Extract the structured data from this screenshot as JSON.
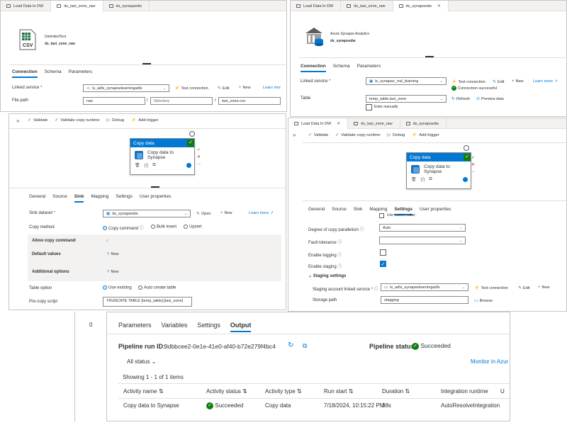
{
  "panel_tl": {
    "tabs": [
      "Load Data In DW",
      "ds_taxi_zone_raw",
      "ds_synaspedw"
    ],
    "dataset_type": "DelimitedText",
    "dataset_name": "ds_taxi_zone_raw",
    "icon_text": "CSV",
    "subtabs": [
      "Connection",
      "Schema",
      "Parameters"
    ],
    "linked_service_label": "Linked service",
    "linked_service_value": "ls_adls_synapselearningadls",
    "test_connection": "Test connection",
    "edit": "Edit",
    "new": "New",
    "learn_more": "Learn mor",
    "file_path_label": "File path",
    "file_path_container": "raw",
    "file_path_directory_placeholder": "Directory",
    "file_path_file": "taxi_zone.csv",
    "slash": "/"
  },
  "panel_tr": {
    "tabs": [
      "Load Data In DW",
      "ds_taxi_zone_raw",
      "ds_synapsedw"
    ],
    "dataset_type": "Azure Synapse Analytics",
    "dataset_name": "ds_synapsedw",
    "subtabs": [
      "Connection",
      "Schema",
      "Parameters"
    ],
    "linked_service_label": "Linked service",
    "linked_service_value": "ls_synapse_rnd_learning",
    "test_connection": "Test connection",
    "connection_status": "Connection successful",
    "edit": "Edit",
    "new": "New",
    "learn_more": "Learn more",
    "table_label": "Table",
    "table_value": "temp_table.taxi_zone",
    "refresh": "Refresh",
    "preview": "Preview data",
    "enter_manually": "Enter manually"
  },
  "panel_ml": {
    "toolbar": [
      "Validate",
      "Validate copy runtime",
      "Debug",
      "Add trigger"
    ],
    "activity_title": "Copy data",
    "activity_name": "Copy data to Synapse",
    "subtabs": [
      "General",
      "Source",
      "Sink",
      "Mapping",
      "Settings",
      "User properties"
    ],
    "sink_dataset_label": "Sink dataset",
    "sink_dataset_value": "ds_synapsedw",
    "open": "Open",
    "new": "New",
    "learn_more": "Learn more",
    "copy_method_label": "Copy method",
    "copy_methods": [
      "Copy command",
      "Bulk insert",
      "Upsert"
    ],
    "allow_copy_command": "Allow copy command",
    "default_values": "Default values",
    "additional_options": "Additional options",
    "table_option_label": "Table option",
    "table_options": [
      "Use existing",
      "Auto create table"
    ],
    "precopy_label": "Pre-copy script",
    "precopy_value": "TRUNCATE TABLE [temp_table].[taxi_zone]",
    "new_plus": "New",
    "expand": "»"
  },
  "panel_mr": {
    "tabs": [
      "Load Data In DW",
      "ds_taxi_zone_raw",
      "ds_synapsedw"
    ],
    "toolbar": [
      "Validate",
      "Validate copy runtime",
      "Debug",
      "Add trigger"
    ],
    "activity_title": "Copy data",
    "activity_name": "Copy data to Synapse",
    "subtabs": [
      "General",
      "Source",
      "Sink",
      "Mapping",
      "Settings",
      "User properties"
    ],
    "use_custom_value": "Use custom value",
    "parallelism_label": "Degree of copy parallelism",
    "parallelism_value": "Auto",
    "fault_label": "Fault tolerance",
    "logging_label": "Enable logging",
    "staging_label": "Enable staging",
    "staging_settings": "Staging settings",
    "staging_ls_label": "Staging account linked service",
    "staging_ls_value": "ls_adls_synapselearningadls",
    "test_connection": "Test connection",
    "edit": "Edit",
    "new": "New",
    "storage_path_label": "Storage path",
    "storage_path_value": "stagging",
    "browse": "Browse",
    "expand": "»"
  },
  "panel_bottom": {
    "side_value": "0",
    "tabs": [
      "Parameters",
      "Variables",
      "Settings",
      "Output"
    ],
    "run_id_label": "Pipeline run ID:",
    "run_id_value": "9dbbcee2-0e1e-41e0-af40-b72e279f4bc4",
    "status_label": "Pipeline status",
    "status_value": "Succeeded",
    "filter": "All status",
    "monitor": "Monitor in Azur",
    "showing": "Showing 1 - 1 of 1 items",
    "columns": [
      "Activity name",
      "Activity status",
      "Activity type",
      "Run start",
      "Duration",
      "Integration runtime",
      "U"
    ],
    "row": [
      "Copy data to Synapse",
      "Succeeded",
      "Copy data",
      "7/18/2024, 10:15:22 PM",
      "38s",
      "AutoResolveIntegration"
    ]
  },
  "colors": {
    "accent": "#0078d4",
    "success": "#107c10"
  }
}
